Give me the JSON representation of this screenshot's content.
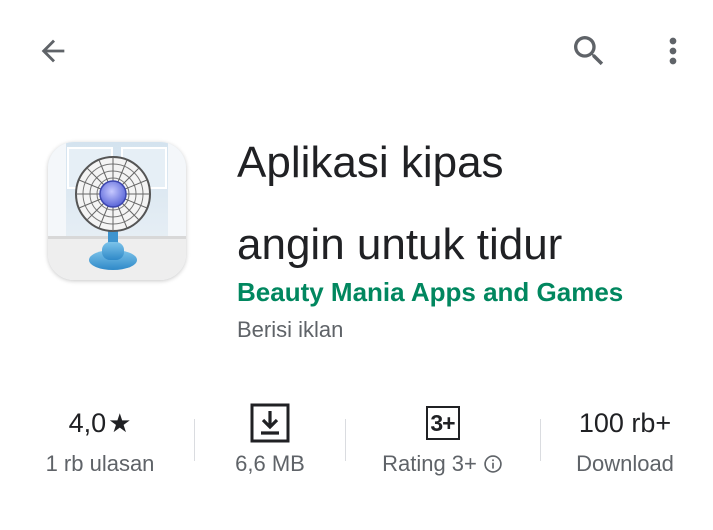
{
  "toolbar": {
    "back_icon": "arrow-back-icon",
    "search_icon": "search-icon",
    "more_icon": "more-vert-icon"
  },
  "app": {
    "icon": "desk-fan-app-icon",
    "title_line1": "Aplikasi kipas",
    "title_line2": "angin untuk tidur",
    "developer": "Beauty Mania Apps and Games",
    "ads_note": "Berisi iklan"
  },
  "stats": {
    "rating_value": "4,0",
    "rating_star": "★",
    "reviews": "1 rb ulasan",
    "size_icon": "download-icon",
    "size": "6,6 MB",
    "content_badge": "3+",
    "content_rating": "Rating 3+",
    "downloads_value": "100 rb+",
    "downloads_label": "Download"
  },
  "colors": {
    "developer": "#01875f",
    "text_primary": "#202124",
    "text_secondary": "#5f6368"
  }
}
